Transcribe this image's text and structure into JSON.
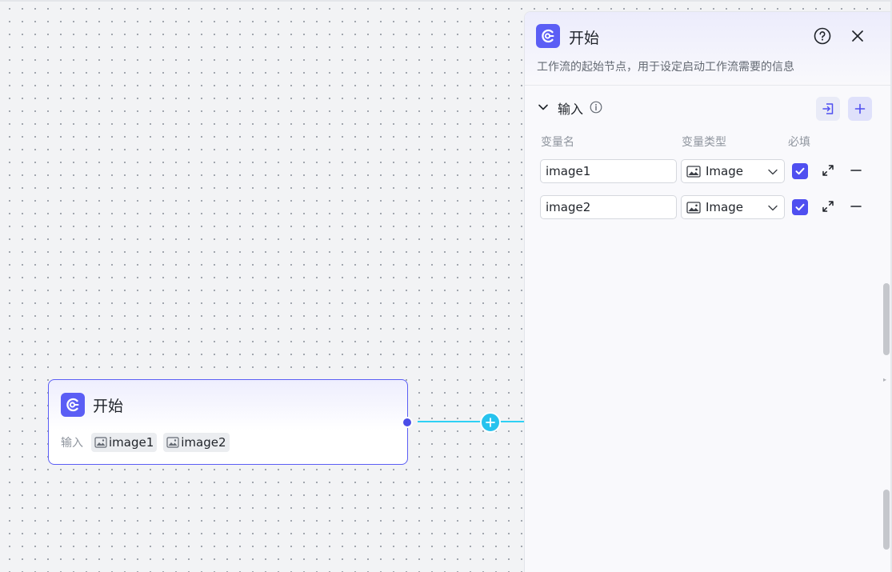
{
  "node": {
    "title": "开始",
    "inputs_label": "输入",
    "inputs": [
      "image1",
      "image2"
    ]
  },
  "panel": {
    "title": "开始",
    "description": "工作流的起始节点，用于设定启动工作流需要的信息",
    "section_title": "输入",
    "columns": {
      "name": "变量名",
      "type": "变量类型",
      "required": "必填"
    },
    "variables": [
      {
        "name": "image1",
        "type": "Image",
        "required": true
      },
      {
        "name": "image2",
        "type": "Image",
        "required": true
      }
    ]
  },
  "colors": {
    "accent": "#5b5ef5",
    "edge": "#2ed0f4",
    "checkbox": "#4f4ff0"
  },
  "icons": [
    "start-node-icon",
    "help-icon",
    "close-icon",
    "chevron-down-icon",
    "info-icon",
    "import-icon",
    "plus-icon",
    "image-icon",
    "check-icon",
    "expand-icon",
    "minus-icon"
  ]
}
